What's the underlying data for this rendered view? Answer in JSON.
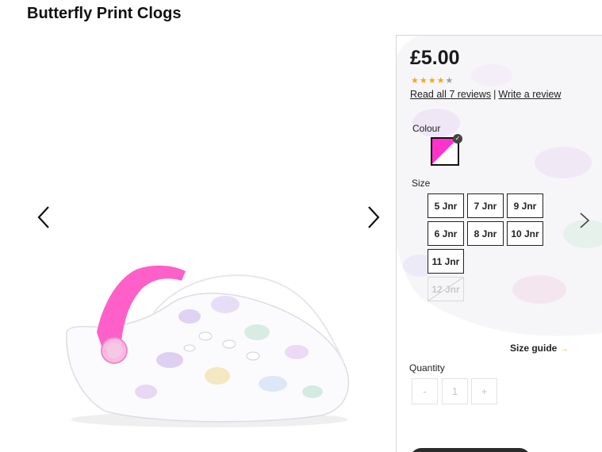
{
  "product": {
    "title": "Butterfly Print Clogs",
    "price": "£5.00",
    "rating": 4.5,
    "rating_max": 5,
    "reviews_link": "Read all 7 reviews",
    "reviews_separator": "|",
    "write_review_link": "Write a review"
  },
  "colour": {
    "label": "Colour",
    "selected_swatch": {
      "primary": "#ff33cc",
      "secondary": "#ffffff"
    }
  },
  "size": {
    "label": "Size",
    "options": [
      {
        "label": "5 Jnr",
        "available": true
      },
      {
        "label": "7 Jnr",
        "available": true
      },
      {
        "label": "9 Jnr",
        "available": true
      },
      {
        "label": "6 Jnr",
        "available": true
      },
      {
        "label": "8 Jnr",
        "available": true
      },
      {
        "label": "10 Jnr",
        "available": true
      },
      {
        "label": "11 Jnr",
        "available": true
      },
      {
        "label": "12 Jnr",
        "available": false
      }
    ],
    "guide_label": "Size guide",
    "guide_arrow": "→"
  },
  "quantity": {
    "label": "Quantity",
    "decrement": "-",
    "value": "1",
    "increment": "+"
  },
  "icons": {
    "prev": "chevron-left-icon",
    "next": "chevron-right-icon"
  },
  "colors": {
    "star": "#f5a623",
    "shoe_strap": "#ff5fc8",
    "accent_arrow": "#f0b400"
  }
}
